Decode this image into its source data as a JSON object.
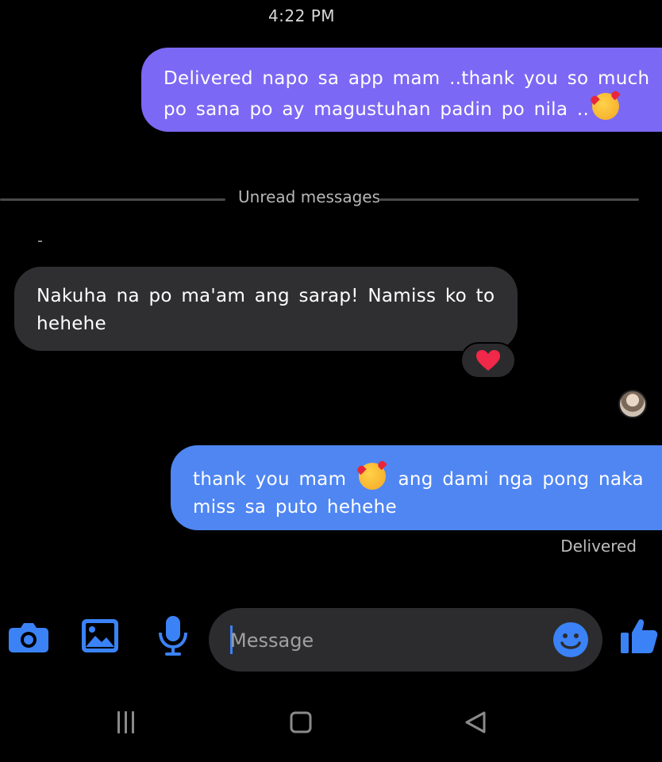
{
  "header": {
    "timestamp": "4:22 PM"
  },
  "messages": [
    {
      "direction": "outgoing",
      "text_before": "Delivered napo sa app mam ..thank you so much po sana po ay magustuhan padin po nila ..",
      "emoji": "smiling-face-with-hearts"
    },
    {
      "direction": "incoming",
      "text": "Nakuha na po ma'am ang sarap! Namiss ko to hehehe",
      "reaction": "red-heart"
    },
    {
      "direction": "outgoing",
      "text_before": "thank you mam",
      "emoji": "smiling-face-with-hearts",
      "text_after": "ang dami nga pong naka miss sa puto hehehe"
    }
  ],
  "divider": {
    "label": "Unread messages"
  },
  "status": {
    "label": "Delivered"
  },
  "composer": {
    "placeholder": "Message",
    "icons": [
      "camera-icon",
      "image-icon",
      "microphone-icon",
      "emoji-icon",
      "thumbs-up-icon"
    ]
  },
  "navigation": {
    "icons": [
      "menu-icon",
      "home-icon",
      "back-icon"
    ]
  },
  "colors": {
    "outgoing_purple": "#7b68f4",
    "outgoing_blue": "#4f86f2",
    "incoming_bg": "#2f2f31",
    "accent": "#3b82f6",
    "background": "#000000"
  }
}
